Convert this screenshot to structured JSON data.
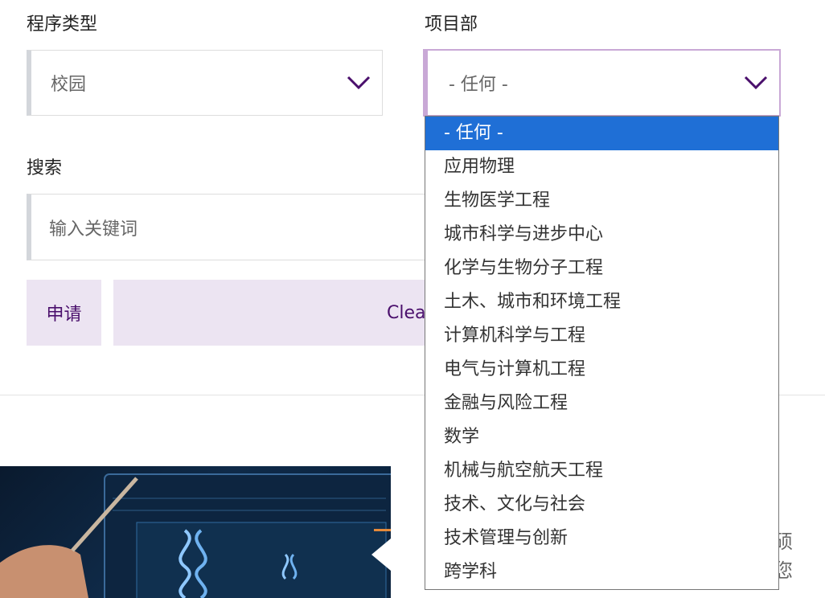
{
  "filters": {
    "program_type_label": "程序类型",
    "program_type_value": "校园",
    "department_label": "项目部",
    "department_value": "- 任何 -",
    "search_label": "搜索",
    "search_placeholder": "输入关键词"
  },
  "buttons": {
    "apply_label": "申请",
    "clear_label": "Clea"
  },
  "dropdown": {
    "options": [
      "- 任何 -",
      "应用物理",
      "生物医学工程",
      "城市科学与进步中心",
      "化学与生物分子工程",
      "土木、城市和环境工程",
      "计算机科学与工程",
      "电气与计算机工程",
      "金融与风险工程",
      "数学",
      "机械与航空航天工程",
      "技术、文化与社会",
      "技术管理与创新",
      "跨学科"
    ],
    "selected_index": 0
  },
  "content": {
    "right_fragment_1": "硕",
    "right_fragment_2": "您"
  },
  "colors": {
    "accent_purple": "#4a0f6c",
    "button_bg": "#ece4f2",
    "selected_bg": "#1f6fd6",
    "open_border": "#c9a8d6"
  }
}
